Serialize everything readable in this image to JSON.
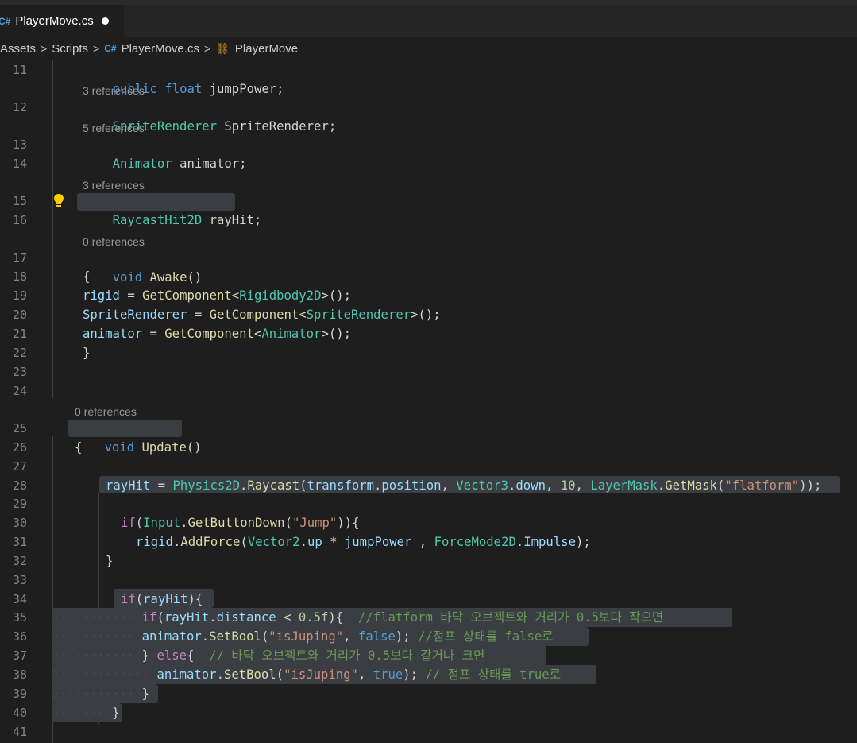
{
  "tab": {
    "icon": "csharp-file-icon",
    "title": "PlayerMove.cs",
    "unsaved": true
  },
  "breadcrumb": {
    "items": [
      "Assets",
      "Scripts",
      "PlayerMove.cs",
      "PlayerMove"
    ],
    "separator": ">"
  },
  "codelens": {
    "l12": "3 references",
    "l13": "5 references",
    "l15": "3 references",
    "l17": "0 references",
    "l25": "0 references"
  },
  "line_numbers": [
    "11",
    "12",
    "13",
    "14",
    "15",
    "16",
    "17",
    "18",
    "19",
    "20",
    "21",
    "22",
    "23",
    "24",
    "25",
    "26",
    "27",
    "28",
    "29",
    "30",
    "31",
    "32",
    "33",
    "34",
    "35",
    "36",
    "37",
    "38",
    "39",
    "40",
    "41"
  ],
  "code": {
    "l11": [
      "public",
      "float",
      "jumpPower;"
    ],
    "l12": [
      "SpriteRenderer",
      "SpriteRenderer;"
    ],
    "l13": [
      "Animator",
      "animator;"
    ],
    "l15": [
      "RaycastHit2D",
      "rayHit;"
    ],
    "l17": [
      "void",
      "Awake",
      "()"
    ],
    "l18": "{",
    "l19": [
      "rigid",
      " = ",
      "GetComponent",
      "<",
      "Rigidbody2D",
      ">();"
    ],
    "l20": [
      "SpriteRenderer",
      " = ",
      "GetComponent",
      "<",
      "SpriteRenderer",
      ">();"
    ],
    "l21": [
      "animator",
      " = ",
      "GetComponent",
      "<",
      "Animator",
      ">();"
    ],
    "l22": "}",
    "l25": [
      "void",
      "Update",
      "()"
    ],
    "l26": "{",
    "l28": [
      "rayHit",
      " = ",
      "Physics2D",
      ".",
      "Raycast",
      "(",
      "transform",
      ".",
      "position",
      ", ",
      "Vector3",
      ".",
      "down",
      ", ",
      "10",
      ", ",
      "LayerMask",
      ".",
      "GetMask",
      "(",
      "\"flatform\"",
      "));"
    ],
    "l30": [
      "if",
      "(",
      "Input",
      ".",
      "GetButtonDown",
      "(",
      "\"Jump\"",
      ")){"
    ],
    "l31": [
      "rigid",
      ".",
      "AddForce",
      "(",
      "Vector2",
      ".",
      "up",
      " * ",
      "jumpPower",
      " , ",
      "ForceMode2D",
      ".",
      "Impulse",
      ");"
    ],
    "l32": "}",
    "l34": [
      "if",
      "(",
      "rayHit",
      "){"
    ],
    "l35": [
      "if",
      "(",
      "rayHit",
      ".",
      "distance",
      " < ",
      "0.5f",
      "){",
      "  //flatform 바닥 오브젝트와 거리가 0.5보다 작으면"
    ],
    "l36": [
      "animator",
      ".",
      "SetBool",
      "(",
      "\"isJuping\"",
      ", ",
      "false",
      "); ",
      "//점프 상태를 false로"
    ],
    "l37": [
      "} ",
      "else",
      "{  ",
      "// 바닥 오브젝트와 거리가 0.5보다 같거나 크면"
    ],
    "l38": [
      "animator",
      ".",
      "SetBool",
      "(",
      "\"isJuping\"",
      ", ",
      "true",
      "); ",
      "// 점프 상태를 true로"
    ],
    "l39": "}",
    "l40": "}"
  },
  "colors": {
    "background": "#1e1e1e",
    "keyword": "#569cd6",
    "type": "#4ec9b0",
    "function": "#dcdcaa",
    "variable": "#9cdcfe",
    "string": "#ce9178",
    "number": "#b5cea8",
    "comment": "#6a9955",
    "control": "#c586c0",
    "selection": "#3a3d41"
  },
  "icons": {
    "lightbulb": "lightbulb-icon",
    "breadcrumb_class": "class-icon"
  }
}
